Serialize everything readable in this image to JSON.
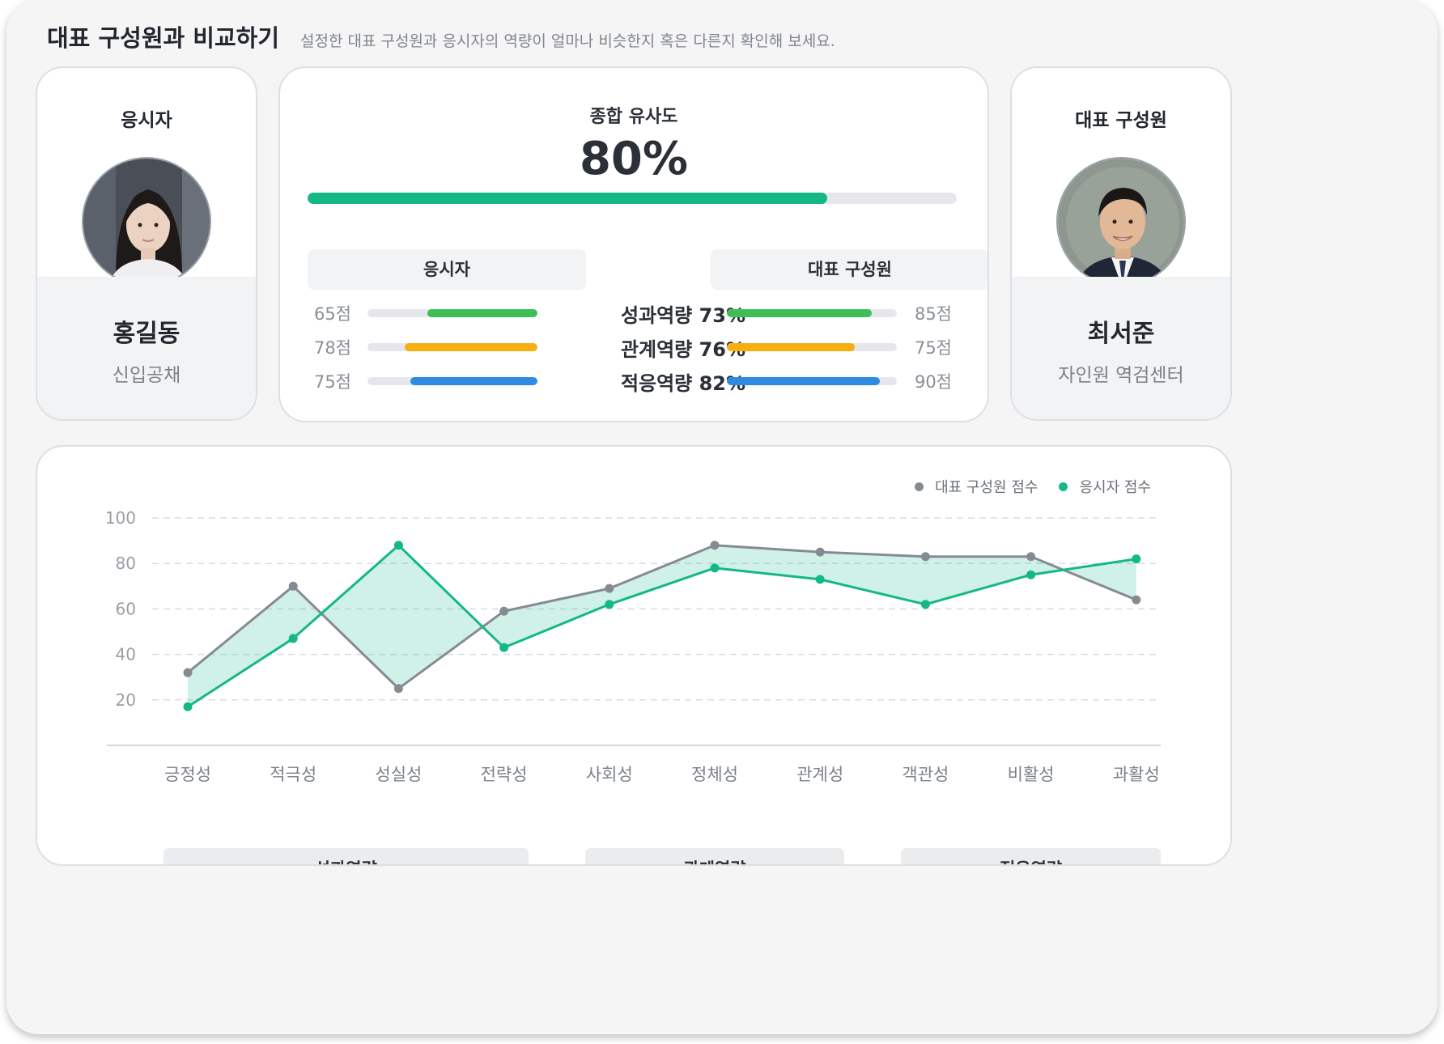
{
  "header": {
    "title": "대표 구성원과 비교하기",
    "subtitle": "설정한 대표 구성원과 응시자의 역량이 얼마나 비슷한지 혹은 다른지 확인해 보세요."
  },
  "applicant": {
    "label": "응시자",
    "name": "홍길동",
    "role": "신입공채"
  },
  "representative": {
    "label": "대표 구성원",
    "name": "최서준",
    "role": "자인원 역검센터"
  },
  "similarity": {
    "label": "종합 유사도",
    "value": "80%",
    "fraction": 0.8,
    "applicant_header": "응시자",
    "representative_header": "대표 구성원",
    "rows": [
      {
        "name": "성과역량",
        "percent": "73%",
        "applicant_score": "65점",
        "applicant_value": 65,
        "rep_score": "85점",
        "rep_value": 85,
        "color": "#3fbe55"
      },
      {
        "name": "관계역량",
        "percent": "76%",
        "applicant_score": "78점",
        "applicant_value": 78,
        "rep_score": "75점",
        "rep_value": 75,
        "color": "#f7ae0f"
      },
      {
        "name": "적응역량",
        "percent": "82%",
        "applicant_score": "75점",
        "applicant_value": 75,
        "rep_score": "90점",
        "rep_value": 90,
        "color": "#2d8be0"
      }
    ],
    "track_color": "#e5e7ea",
    "accent": "#14b886"
  },
  "chart_data": {
    "type": "line",
    "categories": [
      "긍정성",
      "적극성",
      "성실성",
      "전략성",
      "사회성",
      "정체성",
      "관계성",
      "객관성",
      "비활성",
      "과활성"
    ],
    "series": [
      {
        "name": "대표 구성원 점수",
        "color": "#868b93",
        "values": [
          32,
          70,
          25,
          59,
          69,
          88,
          85,
          83,
          83,
          64
        ]
      },
      {
        "name": "응시자 점수",
        "color": "#14b886",
        "values": [
          17,
          47,
          88,
          43,
          62,
          78,
          73,
          62,
          75,
          82
        ]
      }
    ],
    "y_ticks": [
      "100",
      "80",
      "60",
      "40",
      "20"
    ],
    "ylim": [
      0,
      100
    ],
    "grid": true,
    "legend_position": "top-right",
    "fill_between": true,
    "groups": [
      {
        "label": "성과역량",
        "span": [
          0,
          3
        ]
      },
      {
        "label": "관계역량",
        "span": [
          4,
          6
        ]
      },
      {
        "label": "적응역량",
        "span": [
          7,
          9
        ]
      }
    ]
  }
}
